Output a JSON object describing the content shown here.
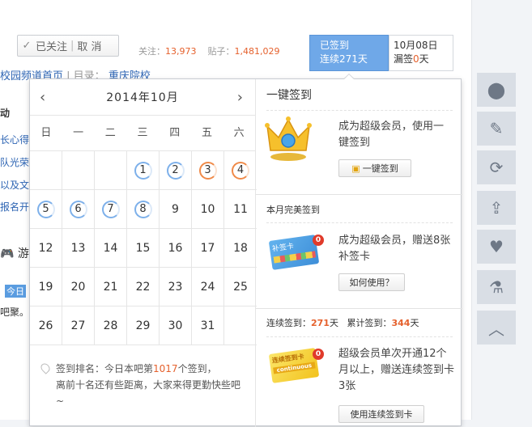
{
  "header": {
    "follow_check": "✓",
    "follow_label": "已关注",
    "unfollow_label": "取 消",
    "follow_stat_label": "关注：",
    "follow_stat_value": "13,973",
    "post_stat_label": "贴子：",
    "post_stat_value": "1,481,029",
    "signed_line1": "已签到",
    "signed_line2": "连续271天",
    "date_line1": "10月08日",
    "date_line2_prefix": "漏签",
    "date_line2_value": "0",
    "date_line2_suffix": "天"
  },
  "breadcrumb": {
    "link1": "校园频道首页",
    "sep": " | 目录：",
    "link2": "重庆院校"
  },
  "background_fragments": [
    "动",
    "长心得",
    "队光荣",
    "以及文",
    "报名开",
    "游",
    "今日",
    "吧聚。 主"
  ],
  "calendar": {
    "title": "2014年10月",
    "prev": "‹",
    "next": "›",
    "weekdays": [
      "日",
      "一",
      "二",
      "三",
      "四",
      "五",
      "六"
    ],
    "days": [
      {
        "n": "",
        "s": ""
      },
      {
        "n": "",
        "s": ""
      },
      {
        "n": "",
        "s": ""
      },
      {
        "n": "1",
        "s": "blue"
      },
      {
        "n": "2",
        "s": "blue"
      },
      {
        "n": "3",
        "s": "orange"
      },
      {
        "n": "4",
        "s": "orange"
      },
      {
        "n": "5",
        "s": "blue"
      },
      {
        "n": "6",
        "s": "blue"
      },
      {
        "n": "7",
        "s": "blue"
      },
      {
        "n": "8",
        "s": "blue"
      },
      {
        "n": "9",
        "s": ""
      },
      {
        "n": "10",
        "s": ""
      },
      {
        "n": "11",
        "s": ""
      },
      {
        "n": "12",
        "s": ""
      },
      {
        "n": "13",
        "s": ""
      },
      {
        "n": "14",
        "s": ""
      },
      {
        "n": "15",
        "s": ""
      },
      {
        "n": "16",
        "s": ""
      },
      {
        "n": "17",
        "s": ""
      },
      {
        "n": "18",
        "s": ""
      },
      {
        "n": "19",
        "s": ""
      },
      {
        "n": "20",
        "s": ""
      },
      {
        "n": "21",
        "s": ""
      },
      {
        "n": "22",
        "s": ""
      },
      {
        "n": "23",
        "s": ""
      },
      {
        "n": "24",
        "s": ""
      },
      {
        "n": "25",
        "s": ""
      },
      {
        "n": "26",
        "s": ""
      },
      {
        "n": "27",
        "s": ""
      },
      {
        "n": "28",
        "s": ""
      },
      {
        "n": "29",
        "s": ""
      },
      {
        "n": "30",
        "s": ""
      },
      {
        "n": "31",
        "s": ""
      },
      {
        "n": "",
        "s": ""
      }
    ],
    "rank_prefix": "签到排名：今日本吧第",
    "rank_value": "1017",
    "rank_suffix": "个签到，",
    "rank_line2": "离前十名还有些距离，大家来得更勤快些吧~"
  },
  "panel": {
    "one_key_title": "一键签到",
    "one_key_text": "成为超级会员，使用一键签到",
    "one_key_button": "一键签到",
    "perfect_title": "本月完美签到",
    "perfect_text": "成为超级会员，赠送8张补签卡",
    "perfect_button": "如何使用？",
    "perfect_card_label": "补签卡",
    "perfect_badge": "0",
    "streak_label": "连续签到：",
    "streak_value": "271",
    "streak_unit": "天",
    "total_label": "累计签到：",
    "total_value": "344",
    "total_unit": "天",
    "streak_text": "超级会员单次开通12个月以上，赠送连续签到卡3张",
    "streak_button": "使用连续签到卡",
    "streak_card_label": "连续签到卡",
    "streak_card_sub": "continuous",
    "streak_badge": "0"
  },
  "rail_icons": [
    "map-pin-icon",
    "edit-icon",
    "refresh-icon",
    "share-icon",
    "heart-icon",
    "flask-icon",
    "back-to-top-icon"
  ],
  "colors": {
    "accent_orange": "#e5612d",
    "signed_blue": "#6fa8e8",
    "link_blue": "#2d64b3"
  }
}
